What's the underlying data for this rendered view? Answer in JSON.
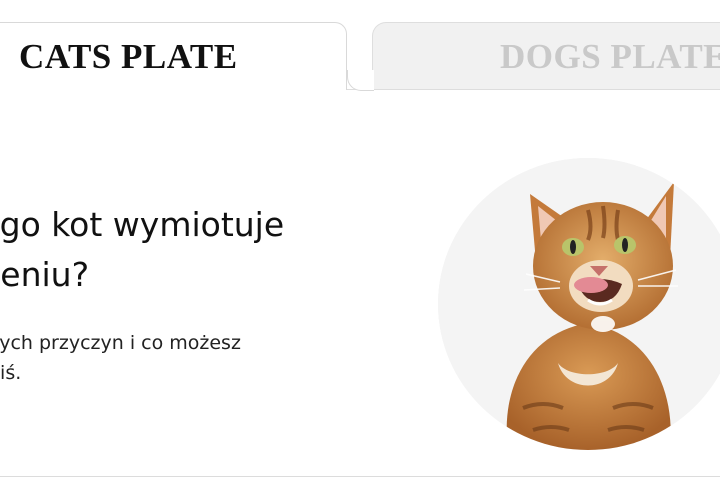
{
  "tabs": [
    {
      "label": "CATS PLATE",
      "active": true
    },
    {
      "label": "DOGS PLATE",
      "active": false
    }
  ],
  "hero": {
    "headline": "zego kot wymiotuje\ndzeniu?",
    "description": "stszych przyczyn i co możesz\nż dziś.",
    "image": "orange-tabby-cat-licking-lips"
  },
  "colors": {
    "active_tab_text": "#111111",
    "inactive_tab_text": "#c9c9c9",
    "inactive_tab_bg": "#f1f1f1",
    "circle_bg": "#f4f4f4",
    "cat_fur": "#c5803e"
  }
}
